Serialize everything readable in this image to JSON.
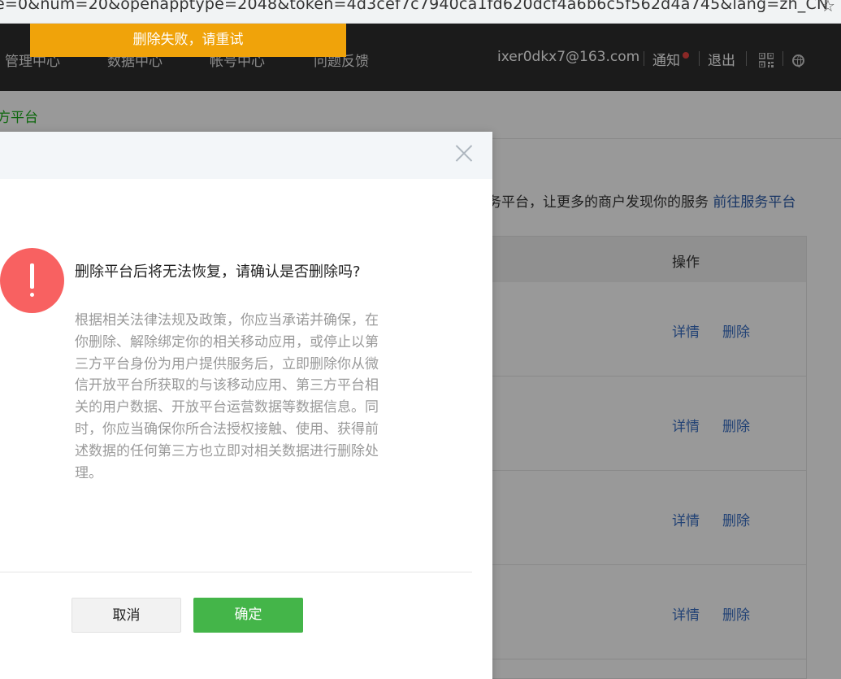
{
  "address_bar": {
    "url_text": "e=0&num=20&openapptype=2048&token=4d3cef7c7940ca1fd620dcf4a6b6c5f562d4a745&lang=zh_CN"
  },
  "nav": {
    "items": [
      "管理中心",
      "数据中心",
      "帐号中心",
      "问题反馈"
    ],
    "email": "ixer0dkx7@163.com",
    "notify": "通知",
    "logout": "退出"
  },
  "toast": {
    "text": "删除失败，请重试"
  },
  "breadcrumb": {
    "current": "方平台"
  },
  "description": {
    "text": "务平台，让更多的商户发现你的服务",
    "link": "前往服务平台"
  },
  "table": {
    "header_op": "操作",
    "rows": [
      {
        "detail": "详情",
        "delete": "删除"
      },
      {
        "detail": "详情",
        "delete": "删除"
      },
      {
        "detail": "详情",
        "delete": "删除"
      },
      {
        "detail": "详情",
        "delete": "删除"
      }
    ]
  },
  "dialog": {
    "title": "删除平台后将无法恢复，请确认是否删除吗?",
    "body": "根据相关法律法规及政策，你应当承诺并确保，在你删除、解除绑定你的相关移动应用，或停止以第三方平台身份为用户提供服务后，立即删除你从微信开放平台所获取的与该移动应用、第三方平台相关的用户数据、开放平台运营数据等数据信息。同时，你应当确保你所合法授权接触、使用、获得前述数据的任何第三方也立即对相关数据进行删除处理。",
    "cancel": "取消",
    "confirm": "确定"
  },
  "colors": {
    "nav_bg": "#2e2e2e",
    "toast_bg": "#f0a30a",
    "warn_red": "#f86161",
    "confirm_green": "#44b549",
    "link_blue": "#3a6fc4"
  }
}
